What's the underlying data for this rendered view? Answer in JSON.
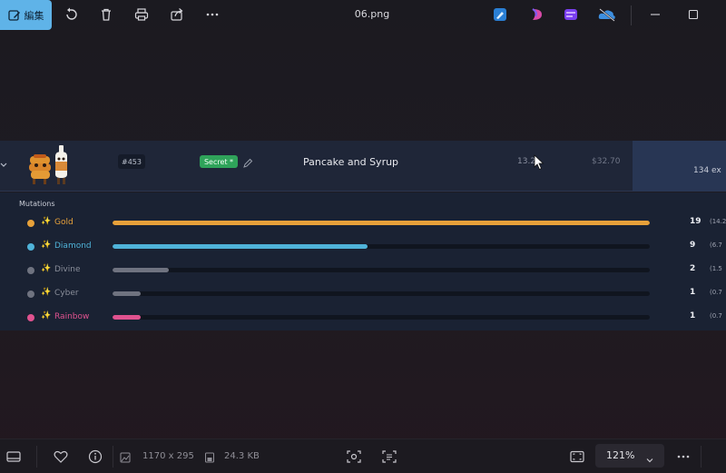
{
  "toolbar": {
    "edit_label": "編集",
    "file_title": "06.png",
    "app_icons": [
      "photos-edit-icon",
      "designer-icon",
      "clipchamp-icon",
      "onedrive-icon"
    ]
  },
  "item": {
    "id": "#453",
    "rarity": "Secret *",
    "name": "Pancake and Syrup",
    "quantity": "13.2",
    "price": "$32.70",
    "exist_text": "134 ex"
  },
  "mutations": {
    "title": "Mutations",
    "rows": [
      {
        "name": "Gold",
        "count": "19",
        "pct": "(14.2",
        "fraction": 1.0,
        "color": "#e7a13a",
        "label_color": "#e7a13a"
      },
      {
        "name": "Diamond",
        "count": "9",
        "pct": "(6.7",
        "fraction": 0.475,
        "color": "#4fb3d9",
        "label_color": "#4fb3d9"
      },
      {
        "name": "Divine",
        "count": "2",
        "pct": "(1.5",
        "fraction": 0.105,
        "color": "#6f7380",
        "label_color": "#8a8e9a"
      },
      {
        "name": "Cyber",
        "count": "1",
        "pct": "(0.7",
        "fraction": 0.053,
        "color": "#6f7380",
        "label_color": "#8a8e9a"
      },
      {
        "name": "Rainbow",
        "count": "1",
        "pct": "(0.7",
        "fraction": 0.053,
        "color": "#e0528f",
        "label_color": "#e0528f"
      }
    ]
  },
  "bottombar": {
    "dimensions": "1170 x 295",
    "file_size": "24.3 KB",
    "zoom": "121%"
  }
}
